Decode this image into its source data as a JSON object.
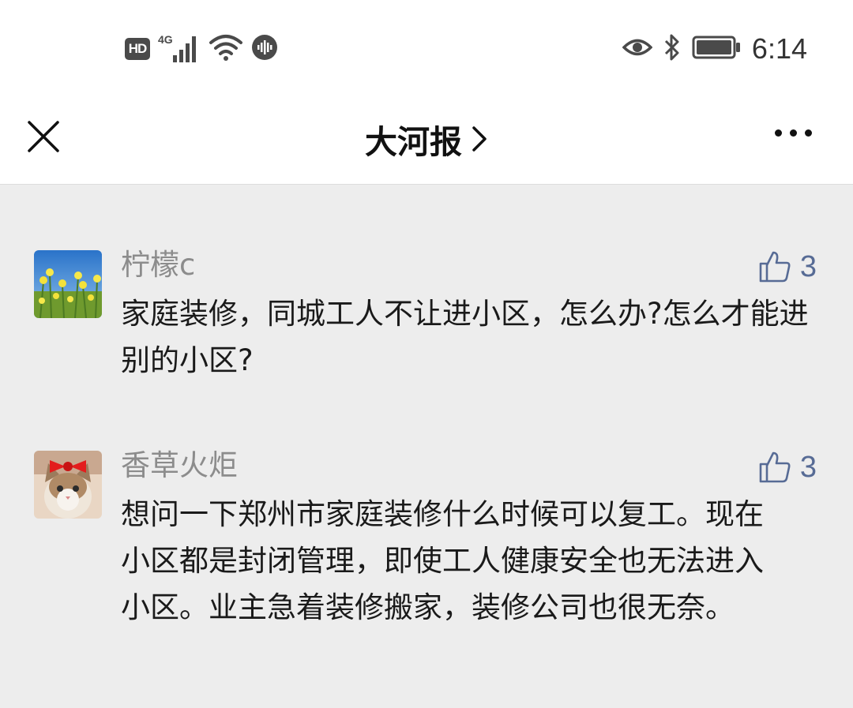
{
  "status_bar": {
    "hd_label": "HD",
    "network_label": "4G",
    "time": "6:14"
  },
  "nav": {
    "title": "大河报",
    "close_icon": "close-icon",
    "more_icon": "more-icon"
  },
  "comments": [
    {
      "author": "柠檬c",
      "likes": "3",
      "text": "家庭装修，同城工人不让进小区，怎么办?怎么才能进别的小区?"
    },
    {
      "author": "香草火炬",
      "likes": "3",
      "text": "想问一下郑州市家庭装修什么时候可以复工。现在小区都是封闭管理，即使工人健康安全也无法进入小区。业主急着装修搬家，装修公司也很无奈。"
    }
  ],
  "colors": {
    "background": "#ededed",
    "like_accent": "#576b95",
    "author_gray": "#8c8c8c"
  }
}
